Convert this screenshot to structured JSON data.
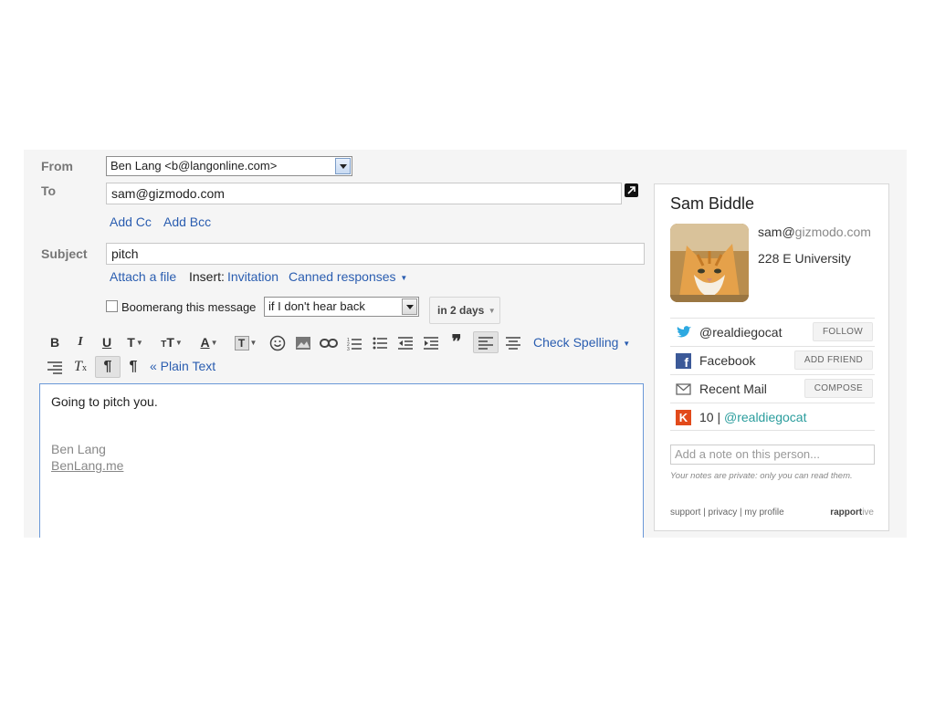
{
  "compose": {
    "from_label": "From",
    "from_value": "Ben Lang <b@langonline.com>",
    "to_label": "To",
    "to_value": "sam@gizmodo.com",
    "add_cc": "Add Cc",
    "add_bcc": "Add Bcc",
    "subject_label": "Subject",
    "subject_value": "pitch",
    "attach_file": "Attach a file",
    "insert_label": "Insert:",
    "invitation": "Invitation",
    "canned_responses": "Canned responses",
    "boomerang_label": "Boomerang this message",
    "boomerang_condition": "if I don't hear back",
    "boomerang_delay": "in 2 days",
    "check_spelling": "Check Spelling",
    "plain_text": "« Plain Text",
    "body_line1": "Going to pitch you.",
    "signature_name": "Ben Lang",
    "signature_link": "BenLang.me"
  },
  "toolbar_icons": [
    "bold-icon",
    "italic-icon",
    "underline-icon",
    "font-icon",
    "font-size-icon",
    "text-color-icon",
    "highlight-icon",
    "emoji-icon",
    "image-icon",
    "link-icon",
    "numbered-list-icon",
    "bulleted-list-icon",
    "indent-less-icon",
    "indent-more-icon",
    "quote-icon",
    "align-left-icon",
    "align-center-icon",
    "align-right-icon",
    "remove-formatting-icon",
    "ltr-icon",
    "rtl-icon"
  ],
  "rapportive": {
    "name": "Sam Biddle",
    "email_user": "sam@",
    "email_domain": "gizmodo.com",
    "location": "228 E University",
    "twitter_handle": "@realdiegocat",
    "twitter_btn": "FOLLOW",
    "facebook_label": "Facebook",
    "facebook_btn": "ADD FRIEND",
    "recent_mail_label": "Recent Mail",
    "recent_mail_btn": "COMPOSE",
    "klout_score": "10 |",
    "klout_handle": "@realdiegocat",
    "note_placeholder": "Add a note on this person...",
    "note_private": "Your notes are private: only you can read them.",
    "footer_support": "support",
    "footer_privacy": "privacy",
    "footer_profile": "my profile",
    "brand_bold": "rapport",
    "brand_light": "ive"
  },
  "colors": {
    "link": "#2a5db0",
    "twitter": "#2da9e1",
    "facebook": "#3b5998",
    "klout": "#e24a1b"
  }
}
